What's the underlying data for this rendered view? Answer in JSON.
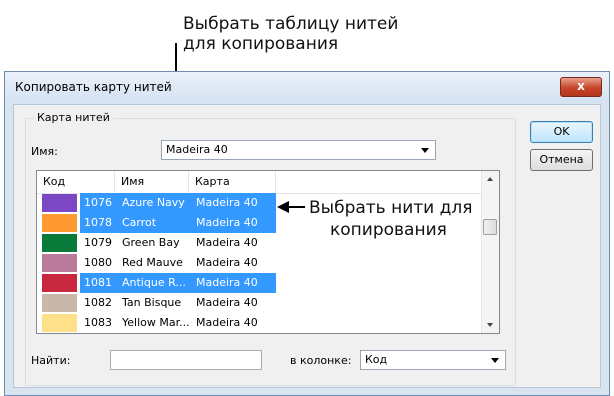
{
  "callouts": {
    "top_line1": "Выбрать таблицу нитей",
    "top_line2": "для копирования",
    "side_line1": "Выбрать нити для",
    "side_line2": "копирования"
  },
  "dialog": {
    "title": "Копировать карту нитей",
    "close_label": "x",
    "group_label": "Карта нитей",
    "name_label": "Имя:",
    "chart_value": "Madeira 40",
    "ok_label": "OK",
    "cancel_label": "Отмена",
    "find_label": "Найти:",
    "find_value": "",
    "column_label": "в колонке:",
    "column_value": "Код"
  },
  "list": {
    "columns": [
      "Код",
      "Имя",
      "Карта"
    ],
    "rows": [
      {
        "color": "#7b47c2",
        "code": "1076",
        "name": "Azure Navy",
        "chart": "Madeira 40",
        "selected": true
      },
      {
        "color": "#ff9a33",
        "code": "1078",
        "name": "Carrot",
        "chart": "Madeira 40",
        "selected": true
      },
      {
        "color": "#0a7a3a",
        "code": "1079",
        "name": "Green Bay",
        "chart": "Madeira 40",
        "selected": false
      },
      {
        "color": "#b97a9b",
        "code": "1080",
        "name": "Red Mauve",
        "chart": "Madeira 40",
        "selected": false
      },
      {
        "color": "#c8283f",
        "code": "1081",
        "name": "Antique R...",
        "chart": "Madeira 40",
        "selected": true
      },
      {
        "color": "#c8b8ab",
        "code": "1082",
        "name": "Tan Bisque",
        "chart": "Madeira 40",
        "selected": false
      },
      {
        "color": "#ffe08a",
        "code": "1083",
        "name": "Yellow Mar...",
        "chart": "Madeira 40",
        "selected": false
      }
    ]
  }
}
